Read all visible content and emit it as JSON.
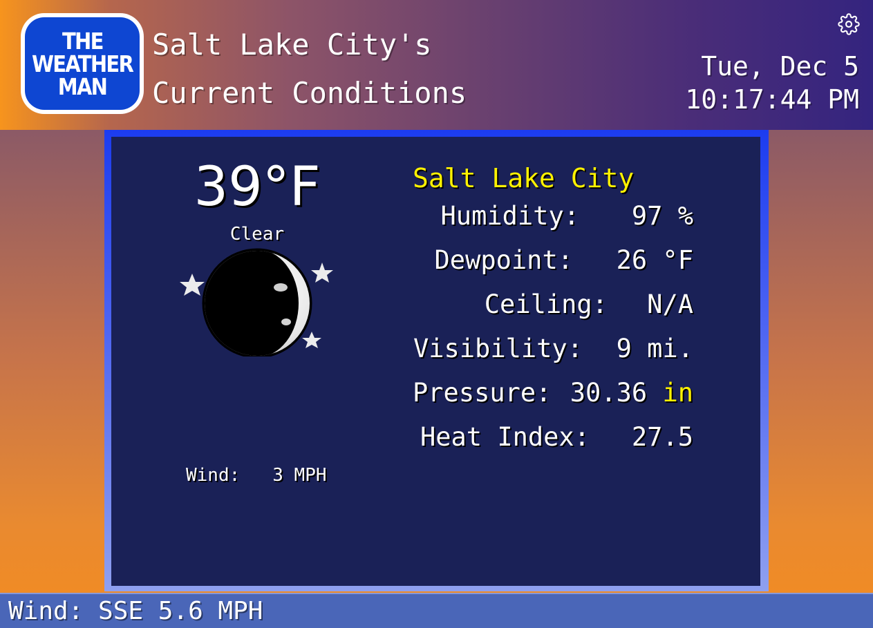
{
  "header": {
    "logo_lines": [
      "THE",
      "WEATHER",
      "MAN"
    ],
    "title_line1": "Salt Lake City's",
    "title_line2": "Current Conditions",
    "date": "Tue, Dec 5",
    "time": "10:17:44 PM",
    "settings_icon": "gear-icon"
  },
  "current": {
    "temperature": "39°F",
    "condition": "Clear",
    "condition_icon": "moon-stars-icon",
    "wind_label": "Wind:",
    "wind_value": "3 MPH"
  },
  "details": {
    "city": "Salt Lake City",
    "rows": [
      {
        "label": "Humidity:",
        "value": "97 %"
      },
      {
        "label": "Dewpoint:",
        "value": "26 °F"
      },
      {
        "label": "Ceiling:",
        "value": "N/A"
      },
      {
        "label": "Visibility:",
        "value": "9 mi."
      },
      {
        "label": "Pressure:",
        "value": "30.36",
        "unit": "in"
      },
      {
        "label": "Heat Index:",
        "value": "27.5"
      }
    ]
  },
  "ticker": {
    "text": "Wind: SSE 5.6 MPH"
  },
  "colors": {
    "accent_yellow": "#fff200",
    "panel_bg": "#1a2157",
    "bottom_bar": "#4a66b8",
    "logo_blue": "#0e46d2"
  }
}
